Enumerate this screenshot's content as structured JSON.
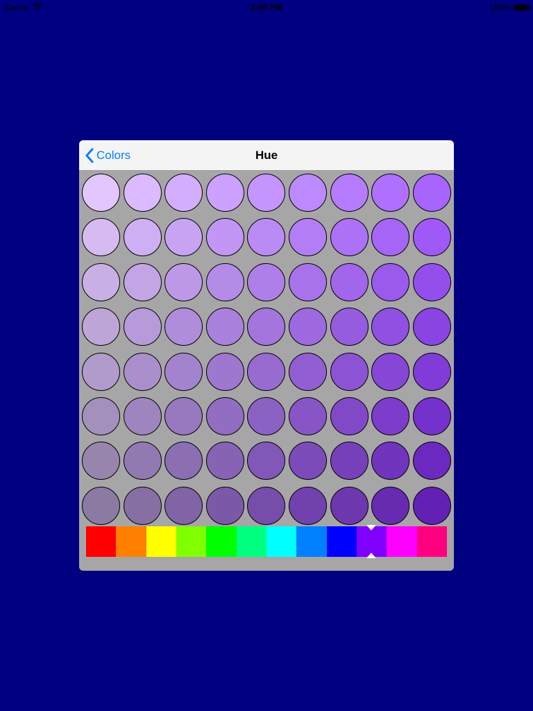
{
  "status_bar": {
    "carrier": "Carrier",
    "time": "8:40 PM",
    "battery": "100%"
  },
  "navbar": {
    "back_label": "Colors",
    "title": "Hue"
  },
  "colors": {
    "background": "#000080",
    "panel": "#a6a6a6",
    "accent": "#0a7bff"
  },
  "swatch_rows": [
    [
      "#e2c6ff",
      "#dbbaff",
      "#d3aeff",
      "#cca1ff",
      "#c595ff",
      "#bd89ff",
      "#b67cff",
      "#af70ff",
      "#a764ff"
    ],
    [
      "#d6bbf2",
      "#cfaff3",
      "#c8a3f4",
      "#c196f4",
      "#ba8af5",
      "#b37ef5",
      "#ac71f6",
      "#a565f7",
      "#9e59f7"
    ],
    [
      "#c9b0e4",
      "#c3a4e5",
      "#bc98e7",
      "#b58be8",
      "#af7fe9",
      "#a873ea",
      "#a166eb",
      "#9a5aec",
      "#944eed"
    ],
    [
      "#bda6d7",
      "#b79ad9",
      "#b08dda",
      "#aa81dc",
      "#a375dd",
      "#9d69df",
      "#965ce0",
      "#9050e2",
      "#8944e3"
    ],
    [
      "#b09bca",
      "#aa8fcc",
      "#a483ce",
      "#9e77cf",
      "#986bd1",
      "#925fd3",
      "#8c53d4",
      "#8647d6",
      "#803bd8"
    ],
    [
      "#a490bc",
      "#9e85be",
      "#9879c0",
      "#926dc2",
      "#8c61c4",
      "#8755c6",
      "#8149c8",
      "#7b3dca",
      "#7531cc"
    ],
    [
      "#9785ae",
      "#917ab1",
      "#8c6eb3",
      "#8663b5",
      "#8157b7",
      "#7b4cb9",
      "#7640bb",
      "#7034bd",
      "#6b29bf"
    ],
    [
      "#8b7aa1",
      "#8670a3",
      "#8064a6",
      "#7b59a8",
      "#764eaa",
      "#7142ad",
      "#6c37af",
      "#672bb1",
      "#6220b4"
    ]
  ],
  "hue_segments": [
    {
      "color": "#ff0000",
      "selected": false
    },
    {
      "color": "#ff8000",
      "selected": false
    },
    {
      "color": "#ffff00",
      "selected": false
    },
    {
      "color": "#80ff00",
      "selected": false
    },
    {
      "color": "#00ff00",
      "selected": false
    },
    {
      "color": "#00ff80",
      "selected": false
    },
    {
      "color": "#00ffff",
      "selected": false
    },
    {
      "color": "#0080ff",
      "selected": false
    },
    {
      "color": "#0000ff",
      "selected": false
    },
    {
      "color": "#8000ff",
      "selected": true
    },
    {
      "color": "#ff00ff",
      "selected": false
    },
    {
      "color": "#ff0080",
      "selected": false
    }
  ]
}
